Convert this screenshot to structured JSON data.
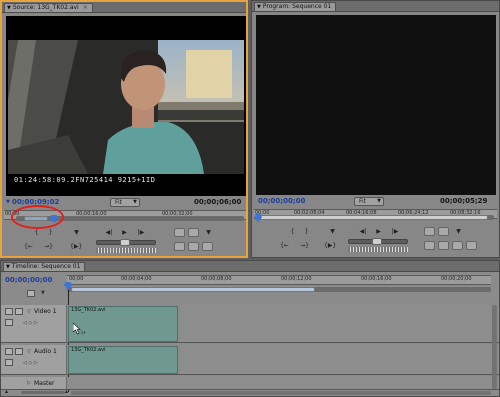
{
  "source_panel": {
    "tab_label": "Source: 13G_TK02.avi",
    "video_overlay_timecode": "01:24:58:09.2FN725414 9215+1ID",
    "current_time": "00;00;09;02",
    "fit_label": "Fit",
    "duration": "00;00;06;00",
    "ruler_labels": [
      "00;00",
      "00;00;16;00",
      "00;00;32;00"
    ]
  },
  "program_panel": {
    "tab_label": "Program: Sequence 01",
    "current_time": "00;00;00;00",
    "fit_label": "Fit",
    "duration": "00;00;05;29",
    "ruler_labels": [
      "00;00",
      "00;02;08;04",
      "00;04;16;08",
      "00;06;24;12",
      "00;08;32;16"
    ]
  },
  "timeline": {
    "tab_label": "Timeline: Sequence 01",
    "current_time": "00;00;00;00",
    "ruler_labels": [
      "00;00",
      "00;00;04;00",
      "00;00;08;00",
      "00;00;12;00",
      "00;00;16;00",
      "00;00;20;00"
    ],
    "tracks": {
      "video1": {
        "name": "Video 1",
        "clip": "13G_TK02.avi"
      },
      "audio1": {
        "name": "Audio 1",
        "clip": "13G_TK02.avi"
      },
      "master": {
        "name": "Master"
      }
    }
  },
  "colors": {
    "active_panel_border": "#e8a43a",
    "timecode_blue": "#1f3d9c",
    "clip_teal": "#6f9890",
    "highlight_circle": "#e0201c"
  },
  "icons": {
    "mark_in": "{",
    "mark_out": "}",
    "play": "▶",
    "step_back": "◀|",
    "step_forward": "|▶",
    "marker": "▼"
  }
}
